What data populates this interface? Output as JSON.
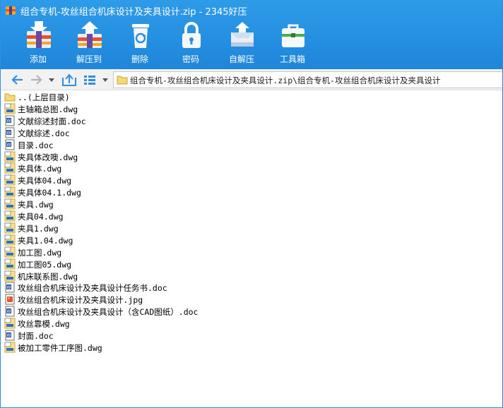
{
  "window": {
    "title": "组合专机-攻丝组合机床设计及夹具设计.zip - 2345好压"
  },
  "toolbar": {
    "items": [
      {
        "label": "添加",
        "icon": "add-archive-icon"
      },
      {
        "label": "解压到",
        "icon": "extract-icon"
      },
      {
        "label": "删除",
        "icon": "recycle-bin-icon"
      },
      {
        "label": "密码",
        "icon": "lock-icon"
      },
      {
        "label": "自解压",
        "icon": "self-extract-icon"
      },
      {
        "label": "工具箱",
        "icon": "toolbox-icon"
      }
    ]
  },
  "navigation": {
    "path": "组合专机-攻丝组合机床设计及夹具设计.zip\\组合专机-攻丝组合机床设计及夹具设计",
    "icons": [
      "back-arrow-icon",
      "forward-arrow-icon",
      "dropdown-arrow-icon",
      "up-folder-icon",
      "view-mode-icon",
      "view-dropdown-icon",
      "folder-icon"
    ]
  },
  "files": [
    {
      "name": "..(上层目录)",
      "type": "folder"
    },
    {
      "name": "主轴箱总图.dwg",
      "type": "dwg"
    },
    {
      "name": "文献综述封面.doc",
      "type": "doc"
    },
    {
      "name": "文献综述.doc",
      "type": "doc"
    },
    {
      "name": "目录.doc",
      "type": "doc"
    },
    {
      "name": "夹具体改噢.dwg",
      "type": "dwg"
    },
    {
      "name": "夹具体.dwg",
      "type": "dwg"
    },
    {
      "name": "夹具体04.dwg",
      "type": "dwg"
    },
    {
      "name": "夹具体04.1.dwg",
      "type": "dwg"
    },
    {
      "name": "夹具.dwg",
      "type": "dwg"
    },
    {
      "name": "夹具04.dwg",
      "type": "dwg"
    },
    {
      "name": "夹具1.dwg",
      "type": "dwg"
    },
    {
      "name": "夹具1.04.dwg",
      "type": "dwg"
    },
    {
      "name": "加工图.dwg",
      "type": "dwg"
    },
    {
      "name": "加工图05.dwg",
      "type": "dwg"
    },
    {
      "name": "机床联系图.dwg",
      "type": "dwg"
    },
    {
      "name": "攻丝组合机床设计及夹具设计任务书.doc",
      "type": "doc"
    },
    {
      "name": "攻丝组合机床设计及夹具设计.jpg",
      "type": "jpg"
    },
    {
      "name": "攻丝组合机床设计及夹具设计（含CAD图纸）.doc",
      "type": "doc"
    },
    {
      "name": "攻丝靠模.dwg",
      "type": "dwg"
    },
    {
      "name": "封面.doc",
      "type": "doc"
    },
    {
      "name": "被加工零件工序图.dwg",
      "type": "dwg"
    }
  ],
  "colors": {
    "header_top": "#2e9be8",
    "header_bottom": "#1f86da",
    "nav_arrow": "#2f8ee0"
  }
}
